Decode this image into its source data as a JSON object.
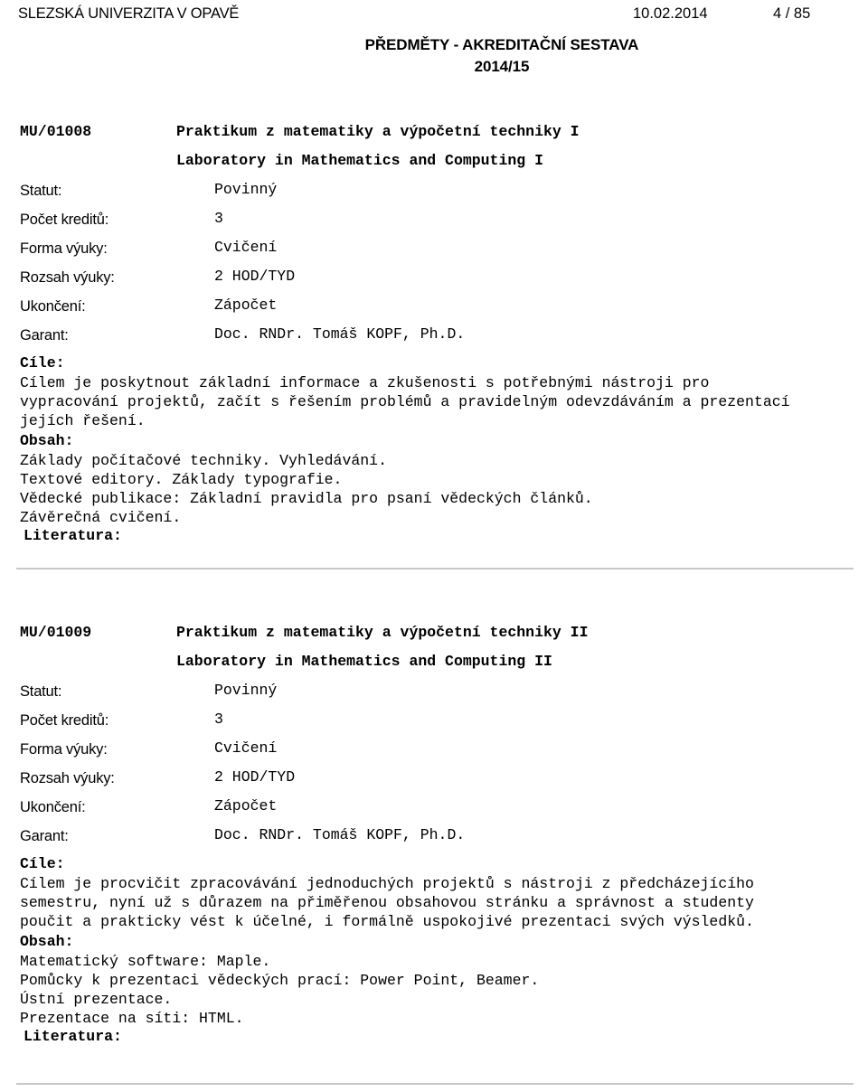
{
  "header": {
    "university": "SLEZSKÁ UNIVERZITA V OPAVĚ",
    "date": "10.02.2014",
    "page": "4 / 85"
  },
  "document_title": {
    "main": "PŘEDMĚTY - AKREDITAČNÍ SESTAVA",
    "subtitle": "2014/15"
  },
  "labels": {
    "statut": "Statut:",
    "kredity": "Počet kreditů:",
    "forma": "Forma výuky:",
    "rozsah": "Rozsah výuky:",
    "ukonceni": "Ukončení:",
    "garant": "Garant:",
    "cile": "Cíle:",
    "obsah": "Obsah:",
    "literatura": "Literatura:"
  },
  "courses": [
    {
      "code": "MU/01008",
      "name_cz": "Praktikum z matematiky a výpočetní techniky I",
      "name_en": "Laboratory in Mathematics and Computing I",
      "statut": "Povinný",
      "kredity": "3",
      "forma": "Cvičení",
      "rozsah": "2 HOD/TYD",
      "ukonceni": "Zápočet",
      "garant": "Doc. RNDr. Tomáš KOPF, Ph.D.",
      "cile": "Cílem je poskytnout základní informace a zkušenosti s potřebnými nástroji pro vypracování projektů, začít s řešením problémů a pravidelným odevzdáváním a prezentací jejích řešení.",
      "obsah_lines": [
        "Základy počítačové techniky. Vyhledávání.",
        "Textové editory. Základy typografie.",
        "Vědecké publikace: Základní pravidla pro psaní vědeckých článků.",
        "Závěrečná cvičení."
      ]
    },
    {
      "code": "MU/01009",
      "name_cz": "Praktikum z matematiky a výpočetní techniky II",
      "name_en": "Laboratory in Mathematics and Computing II",
      "statut": "Povinný",
      "kredity": "3",
      "forma": "Cvičení",
      "rozsah": "2 HOD/TYD",
      "ukonceni": "Zápočet",
      "garant": "Doc. RNDr. Tomáš KOPF, Ph.D.",
      "cile": "Cílem je procvičit zpracovávání jednoduchých projektů s nástroji z předcházejícího semestru, nyní už s důrazem na přiměřenou obsahovou stránku a správnost a studenty poučit a prakticky vést k účelné, i formálně uspokojivé prezentaci svých výsledků.",
      "obsah_lines": [
        "Matematický software: Maple.",
        "Pomůcky k prezentaci vědeckých prací: Power Point, Beamer.",
        "Ústní prezentace.",
        "Prezentace na síti: HTML."
      ]
    }
  ]
}
